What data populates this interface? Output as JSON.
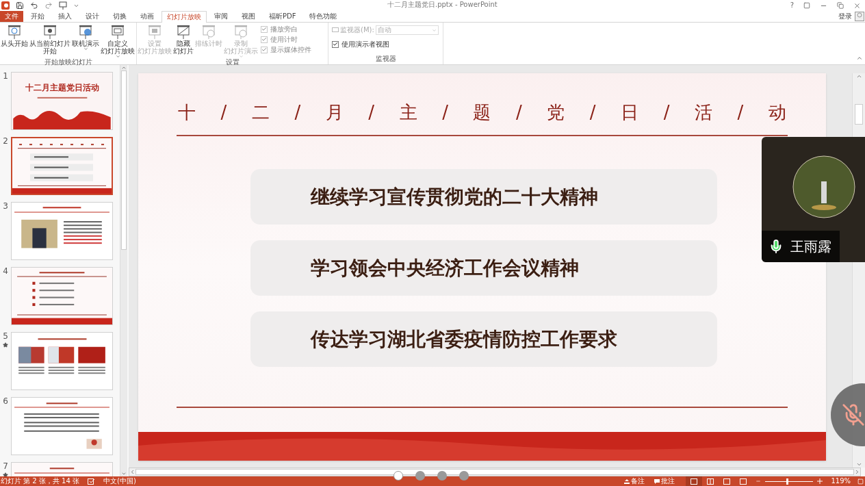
{
  "window": {
    "title": "十二月主题党日.pptx - PowerPoint",
    "help": "?",
    "signin": "登录"
  },
  "ribbon_tabs": [
    {
      "label": "文件",
      "kind": "file",
      "selected": false
    },
    {
      "label": "开始",
      "kind": "tab",
      "selected": false
    },
    {
      "label": "插入",
      "kind": "tab",
      "selected": false
    },
    {
      "label": "设计",
      "kind": "tab",
      "selected": false
    },
    {
      "label": "切换",
      "kind": "tab",
      "selected": false
    },
    {
      "label": "动画",
      "kind": "tab",
      "selected": false
    },
    {
      "label": "幻灯片放映",
      "kind": "tab",
      "selected": true
    },
    {
      "label": "审阅",
      "kind": "tab",
      "selected": false
    },
    {
      "label": "视图",
      "kind": "tab",
      "selected": false
    },
    {
      "label": "福昕PDF",
      "kind": "tab",
      "selected": false
    },
    {
      "label": "特色功能",
      "kind": "tab",
      "selected": false
    }
  ],
  "ribbon_groups": [
    {
      "label": "开始放映幻灯片",
      "controls": [
        {
          "lines": [
            "从头开始"
          ],
          "disabled": false,
          "dropdown": false
        },
        {
          "lines": [
            "从当前幻灯片",
            "开始"
          ],
          "disabled": false,
          "dropdown": false
        },
        {
          "lines": [
            "联机演示"
          ],
          "disabled": false,
          "dropdown": true
        },
        {
          "lines": [
            "自定义",
            "幻灯片放映"
          ],
          "disabled": false,
          "dropdown": true
        }
      ]
    },
    {
      "label": "设置",
      "controls": [
        {
          "lines": [
            "设置",
            "幻灯片放映"
          ],
          "disabled": true,
          "dropdown": false
        },
        {
          "lines": [
            "隐藏",
            "幻灯片"
          ],
          "disabled": false,
          "dropdown": false
        },
        {
          "lines": [
            "排练计时"
          ],
          "disabled": true,
          "dropdown": false
        },
        {
          "lines": [
            "录制",
            "幻灯片演示"
          ],
          "disabled": true,
          "dropdown": true
        }
      ],
      "options": [
        {
          "kind": "checkbox",
          "label": "播放旁白",
          "checked": true,
          "disabled": true
        },
        {
          "kind": "checkbox",
          "label": "使用计时",
          "checked": true,
          "disabled": true
        },
        {
          "kind": "checkbox",
          "label": "显示媒体控件",
          "checked": true,
          "disabled": true
        }
      ]
    },
    {
      "label": "监视器",
      "options": [
        {
          "kind": "select",
          "label": "监视器(M):",
          "value": "自动",
          "disabled": true
        },
        {
          "kind": "checkbox",
          "label": "使用演示者视图",
          "checked": true,
          "disabled": false
        }
      ]
    }
  ],
  "thumbnails": [
    {
      "number": "1",
      "kind": "title",
      "title": "十二月主题党日活动",
      "animated": false,
      "selected": false
    },
    {
      "number": "2",
      "kind": "agenda",
      "animated": false,
      "selected": true
    },
    {
      "number": "3",
      "kind": "photo-text",
      "animated": false,
      "selected": false
    },
    {
      "number": "4",
      "kind": "list",
      "animated": false,
      "selected": false
    },
    {
      "number": "5",
      "kind": "three-photo",
      "animated": true,
      "selected": false
    },
    {
      "number": "6",
      "kind": "text",
      "animated": false,
      "selected": false
    },
    {
      "number": "7",
      "kind": "partial",
      "animated": true,
      "selected": false
    }
  ],
  "slide": {
    "title_parts": [
      "十",
      "/",
      "二",
      "/",
      "月",
      "/",
      "主",
      "/",
      "题",
      "/",
      "党",
      "/",
      "日",
      "/",
      "活",
      "/",
      "动"
    ],
    "items": [
      "继续学习宣传贯彻党的二十大精神",
      "学习领会中央经济工作会议精神",
      "传达学习湖北省委疫情防控工作要求"
    ]
  },
  "video": {
    "name": "王雨露",
    "mic_on": true
  },
  "mute_button": {
    "muted": true
  },
  "page_dots": [
    {
      "selected": true
    },
    {
      "selected": false
    },
    {
      "selected": false
    },
    {
      "selected": false
    }
  ],
  "status_bar": {
    "slide_info": "幻灯片 第 2 张，共 14 张",
    "language": "中文(中国)",
    "notes": "备注",
    "comments": "批注",
    "views": [
      {
        "selected": true
      },
      {
        "selected": false
      },
      {
        "selected": false
      },
      {
        "selected": false
      }
    ],
    "level": 0.43,
    "zoom": "119%"
  }
}
